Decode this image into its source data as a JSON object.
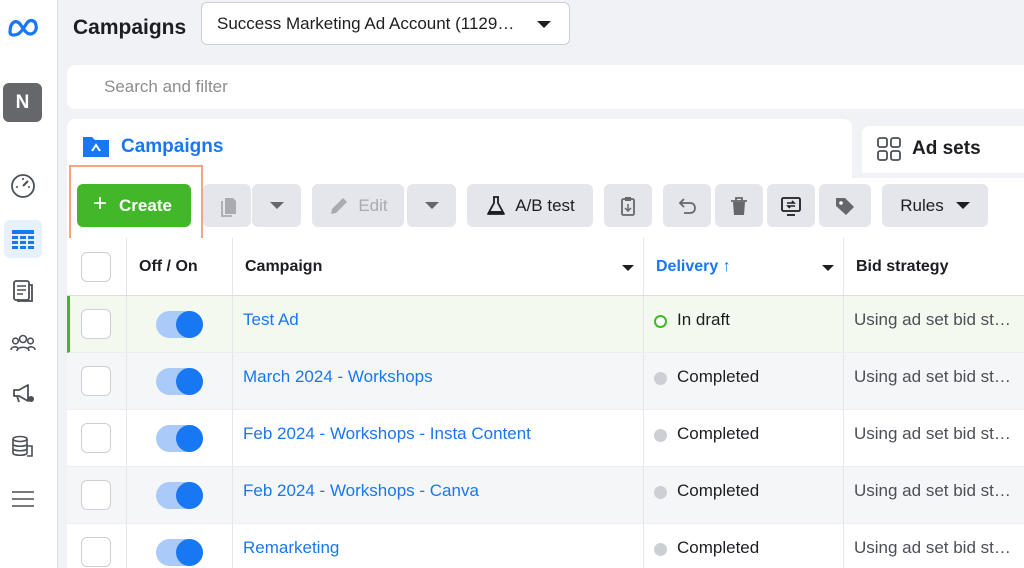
{
  "header": {
    "title": "Campaigns",
    "account": "Success Marketing Ad Account (1129…"
  },
  "sidebar": {
    "avatar_initial": "N",
    "items": [
      {
        "icon": "gauge-icon"
      },
      {
        "icon": "table-grid-icon",
        "active": true
      },
      {
        "icon": "pages-icon"
      },
      {
        "icon": "audience-icon"
      },
      {
        "icon": "megaphone-icon"
      },
      {
        "icon": "billing-icon"
      },
      {
        "icon": "menu-icon"
      }
    ]
  },
  "search": {
    "placeholder": "Search and filter"
  },
  "tabs": {
    "campaigns": "Campaigns",
    "ad_sets": "Ad sets"
  },
  "toolbar": {
    "create": "Create",
    "edit": "Edit",
    "ab_test": "A/B test",
    "rules": "Rules"
  },
  "table": {
    "headers": {
      "toggle": "Off / On",
      "campaign": "Campaign",
      "delivery": "Delivery",
      "bid": "Bid strategy"
    },
    "rows": [
      {
        "name": "Test Ad",
        "delivery": "In draft",
        "bid": "Using ad set bid st…"
      },
      {
        "name": "March 2024 - Workshops",
        "delivery": "Completed",
        "bid": "Using ad set bid st…"
      },
      {
        "name": "Feb 2024 - Workshops - Insta Content",
        "delivery": "Completed",
        "bid": "Using ad set bid st…"
      },
      {
        "name": "Feb 2024 - Workshops - Canva",
        "delivery": "Completed",
        "bid": "Using ad set bid st…"
      },
      {
        "name": "Remarketing",
        "delivery": "Completed",
        "bid": "Using ad set bid st…"
      }
    ]
  },
  "colors": {
    "brand": "#1877f2",
    "create": "#42b72a",
    "highlight": "#f4a582"
  }
}
